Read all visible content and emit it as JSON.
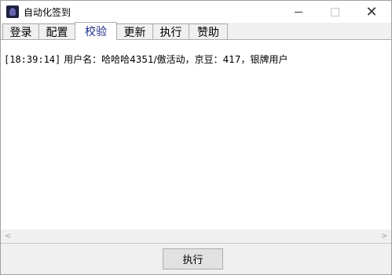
{
  "window": {
    "title": "自动化签到",
    "close_glyph": "✕"
  },
  "tabs": [
    {
      "label": "登录"
    },
    {
      "label": "配置"
    },
    {
      "label": "校验",
      "active": true
    },
    {
      "label": "更新"
    },
    {
      "label": "执行"
    },
    {
      "label": "赞助"
    }
  ],
  "log": {
    "timestamp": "[18:39:14]",
    "message": " 用户名：哈哈哈4351/傲活动，京豆：417，银牌用户"
  },
  "scrollbar": {
    "left_arrow": "<",
    "right_arrow": ">"
  },
  "actions": {
    "run_label": "执行"
  },
  "colors": {
    "active_tab_text": "#1a2a86",
    "panel_background": "#ffffff",
    "window_background": "#f0f0f0"
  }
}
